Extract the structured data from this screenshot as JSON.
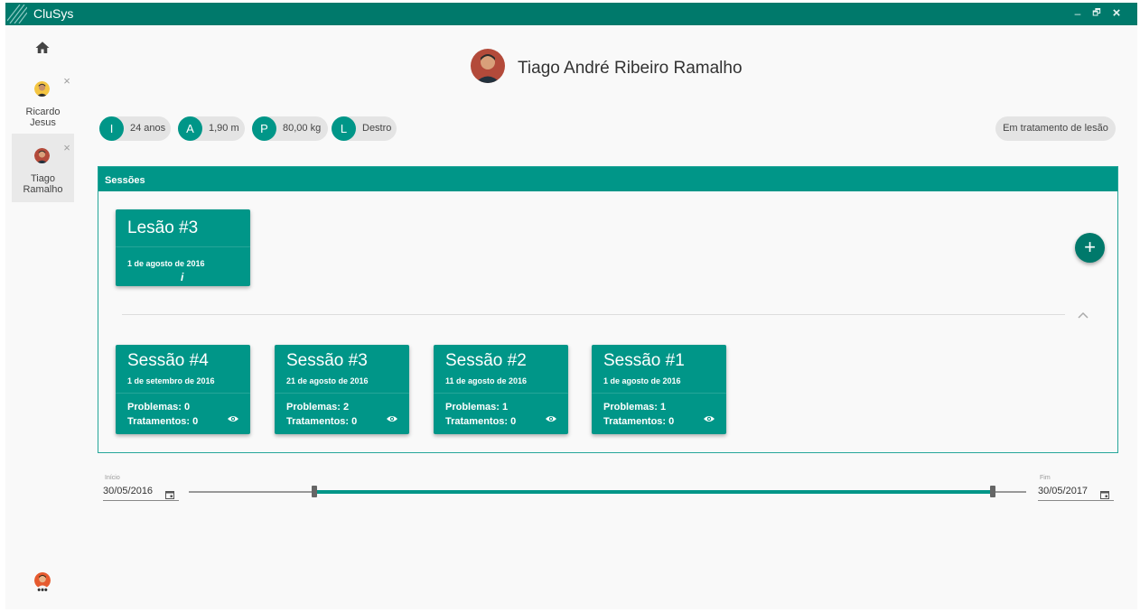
{
  "app": {
    "title": "CluSys"
  },
  "window_controls": {
    "minimize": "–",
    "maximize": "🗗",
    "close": "×"
  },
  "sidebar": {
    "tabs": [
      {
        "name": "Ricardo\nJesus",
        "close": "×"
      },
      {
        "name": "Tiago\nRamalho",
        "close": "×",
        "active": true
      }
    ],
    "more": "•••"
  },
  "patient": {
    "name": "Tiago André Ribeiro Ramalho",
    "chips": [
      {
        "letter": "I",
        "value": "24 anos"
      },
      {
        "letter": "A",
        "value": "1,90 m"
      },
      {
        "letter": "P",
        "value": "80,00 kg"
      },
      {
        "letter": "L",
        "value": "Destro"
      }
    ],
    "status": "Em tratamento de lesão"
  },
  "sessions_panel": {
    "title": "Sessões",
    "injury": {
      "title": "Lesão #3",
      "date": "1 de agosto de 2016",
      "info": "i"
    },
    "add_button": "+",
    "sessions": [
      {
        "title": "Sessão #4",
        "date": "1 de setembro de 2016",
        "problems": "Problemas: 0",
        "treatments": "Tratamentos: 0"
      },
      {
        "title": "Sessão #3",
        "date": "21 de agosto de 2016",
        "problems": "Problemas: 2",
        "treatments": "Tratamentos: 0"
      },
      {
        "title": "Sessão #2",
        "date": "11 de agosto de 2016",
        "problems": "Problemas: 1",
        "treatments": "Tratamentos: 0"
      },
      {
        "title": "Sessão #1",
        "date": "1 de agosto de 2016",
        "problems": "Problemas: 1",
        "treatments": "Tratamentos: 0"
      }
    ]
  },
  "date_range": {
    "start_label": "Início",
    "start_value": "30/05/2016",
    "end_label": "Fim",
    "end_value": "30/05/2017",
    "range_start_fraction": 0.15,
    "range_end_fraction": 0.96
  },
  "colors": {
    "titlebar": "#00796b",
    "accent": "#009688",
    "chip_bg": "#e4e4e4"
  },
  "icons": [
    "home-icon",
    "close-icon",
    "plus-icon",
    "eye-icon",
    "chevron-up-icon",
    "calendar-icon",
    "info-icon"
  ]
}
